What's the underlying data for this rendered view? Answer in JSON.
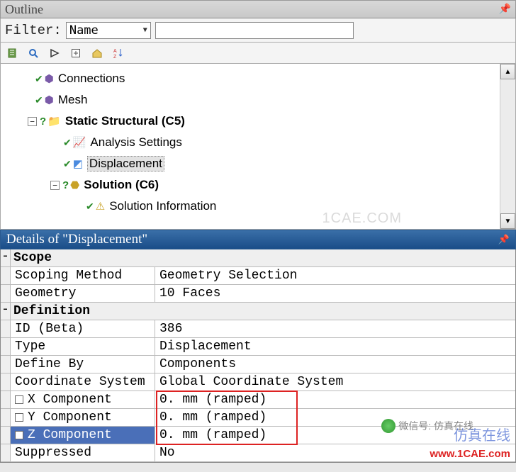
{
  "outline": {
    "title": "Outline",
    "filter_label": "Filter:",
    "filter_option": "Name",
    "filter_value": ""
  },
  "tree": {
    "connections": "Connections",
    "mesh": "Mesh",
    "static_structural": "Static Structural (C5)",
    "analysis_settings": "Analysis Settings",
    "displacement": "Displacement",
    "solution": "Solution (C6)",
    "solution_info": "Solution Information"
  },
  "details": {
    "title": "Details of \"Displacement\"",
    "groups": {
      "scope": "Scope",
      "definition": "Definition"
    },
    "rows": {
      "scoping_method": {
        "label": "Scoping Method",
        "value": "Geometry Selection"
      },
      "geometry": {
        "label": "Geometry",
        "value": "10 Faces"
      },
      "id_beta": {
        "label": "ID (Beta)",
        "value": "386"
      },
      "type": {
        "label": "Type",
        "value": "Displacement"
      },
      "define_by": {
        "label": "Define By",
        "value": "Components"
      },
      "coord_sys": {
        "label": "Coordinate System",
        "value": "Global Coordinate System"
      },
      "x_comp": {
        "label": "X Component",
        "value": "0. mm  (ramped)"
      },
      "y_comp": {
        "label": "Y Component",
        "value": "0. mm  (ramped)"
      },
      "z_comp": {
        "label": "Z Component",
        "value": "0. mm  (ramped)"
      },
      "suppressed": {
        "label": "Suppressed",
        "value": "No"
      }
    }
  },
  "watermarks": {
    "mid": "1CAE.COM",
    "wechat": "微信号: 仿真在线",
    "cn": "仿真在线",
    "url": "www.1CAE.com"
  }
}
